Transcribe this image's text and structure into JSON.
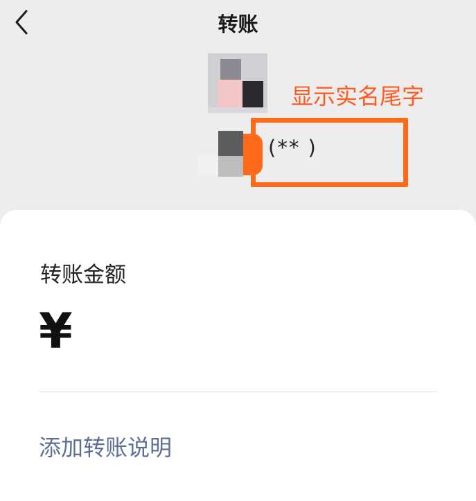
{
  "header": {
    "back_icon": "chevron-left-icon",
    "title": "转账"
  },
  "recipient": {
    "name_suffix": "(**   )"
  },
  "annotation": {
    "text": "显示实名尾字",
    "color": "#ff5a1f"
  },
  "transfer": {
    "amount_label": "转账金额",
    "currency_symbol": "¥",
    "add_note_label": "添加转账说明",
    "link_color": "#5f6f93"
  }
}
